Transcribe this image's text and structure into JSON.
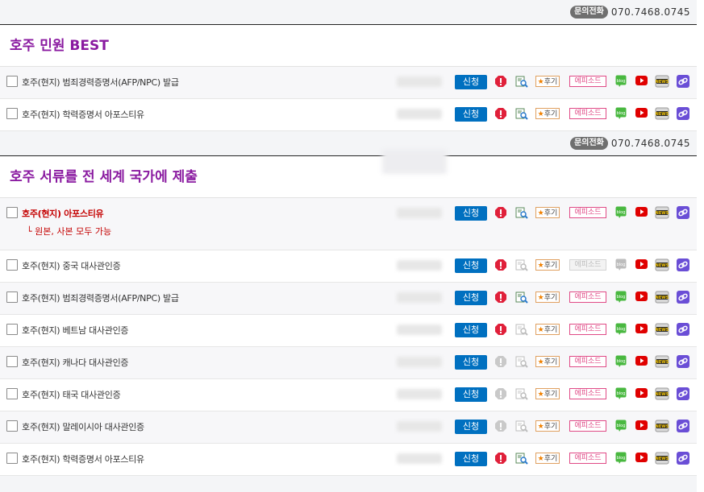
{
  "contact": {
    "badge": "문의전화",
    "number": "070.7468.0745"
  },
  "sections": [
    {
      "title": "호주 민원 BEST",
      "rows": [
        {
          "name": "호주(현지) 범죄경력증명서(AFP/NPC) 발급",
          "highlight": false,
          "subnote": "",
          "warn_active": true,
          "search_active": true,
          "episode_active": true,
          "blog_active": true
        },
        {
          "name": "호주(현지) 학력증명서 아포스티유",
          "highlight": false,
          "subnote": "",
          "warn_active": true,
          "search_active": true,
          "episode_active": true,
          "blog_active": true
        }
      ]
    },
    {
      "title": "호주 서류를 전 세계 국가에 제출",
      "rows": [
        {
          "name": "호주(현지) 아포스티유",
          "highlight": true,
          "subnote": "└ 원본, 사본 모두 가능",
          "warn_active": true,
          "search_active": true,
          "episode_active": true,
          "blog_active": true
        },
        {
          "name": "호주(현지) 중국 대사관인증",
          "highlight": false,
          "subnote": "",
          "warn_active": true,
          "search_active": false,
          "episode_active": false,
          "blog_active": false
        },
        {
          "name": "호주(현지) 범죄경력증명서(AFP/NPC) 발급",
          "highlight": false,
          "subnote": "",
          "warn_active": true,
          "search_active": true,
          "episode_active": true,
          "blog_active": true
        },
        {
          "name": "호주(현지) 베트남 대사관인증",
          "highlight": false,
          "subnote": "",
          "warn_active": true,
          "search_active": false,
          "episode_active": true,
          "blog_active": true
        },
        {
          "name": "호주(현지) 캐나다 대사관인증",
          "highlight": false,
          "subnote": "",
          "warn_active": false,
          "search_active": false,
          "episode_active": true,
          "blog_active": true
        },
        {
          "name": "호주(현지) 태국 대사관인증",
          "highlight": false,
          "subnote": "",
          "warn_active": false,
          "search_active": false,
          "episode_active": true,
          "blog_active": true
        },
        {
          "name": "호주(현지) 말레이시아 대사관인증",
          "highlight": false,
          "subnote": "",
          "warn_active": false,
          "search_active": false,
          "episode_active": true,
          "blog_active": true
        },
        {
          "name": "호주(현지) 학력증명서 아포스티유",
          "highlight": false,
          "subnote": "",
          "warn_active": true,
          "search_active": true,
          "episode_active": true,
          "blog_active": true
        }
      ]
    }
  ],
  "labels": {
    "apply": "신청",
    "review_star": "★",
    "review": "후기",
    "episode": "에피소드",
    "blog": "blog",
    "news": "NEWS"
  },
  "colors": {
    "title": "#8a1aa0",
    "apply": "#0070c0",
    "warn": "#e0203a",
    "youtube": "#e00000",
    "link": "#6a4ed6",
    "blog": "#49b840"
  }
}
